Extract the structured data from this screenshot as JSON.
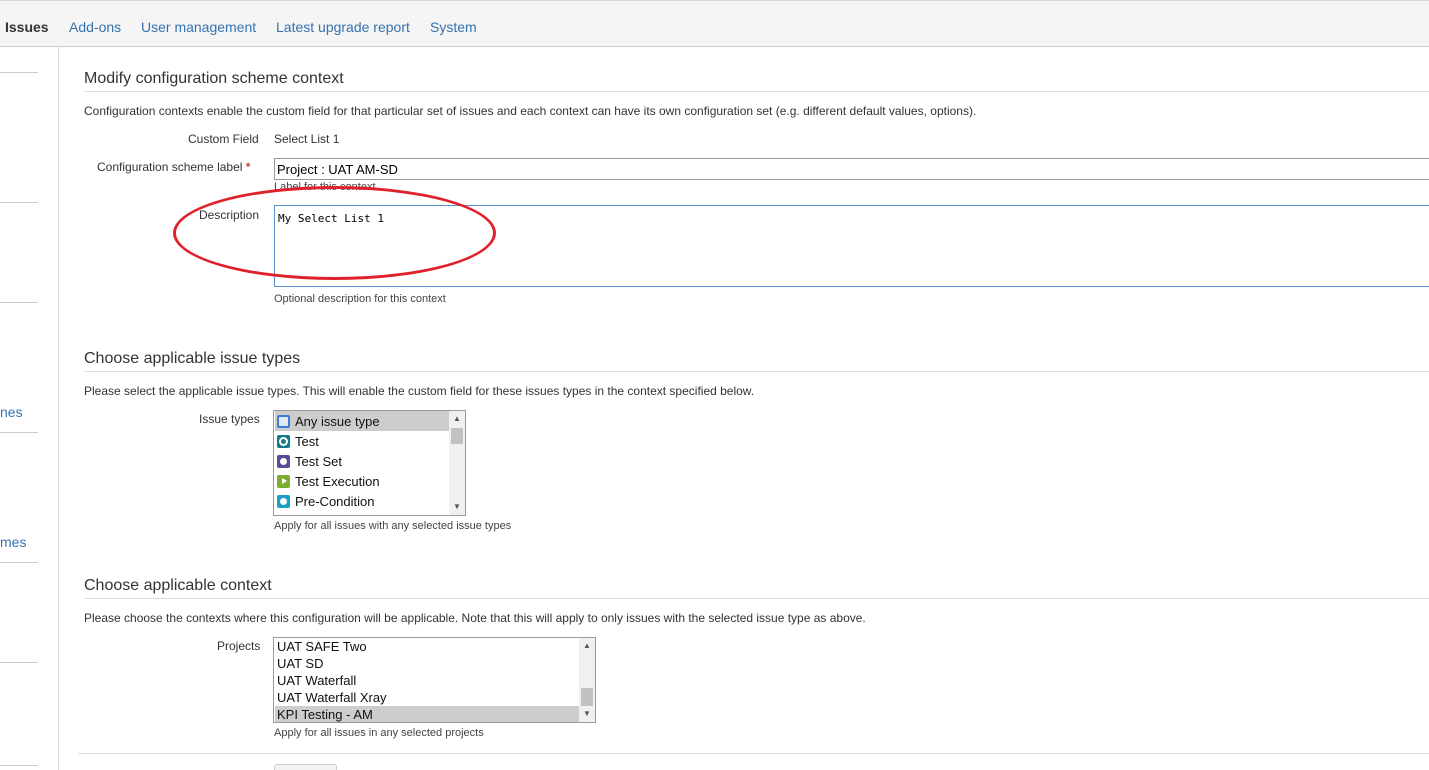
{
  "nav": {
    "tabs": [
      {
        "label": "Issues",
        "active": true
      },
      {
        "label": "Add-ons"
      },
      {
        "label": "User management"
      },
      {
        "label": "Latest upgrade report"
      },
      {
        "label": "System"
      }
    ]
  },
  "sidebar": {
    "fragments": [
      "nes",
      "mes"
    ]
  },
  "form": {
    "title": "Modify configuration scheme context",
    "intro": "Configuration contexts enable the custom field for that particular set of issues and each context can have its own configuration set (e.g. different default values, options).",
    "custom_field_label": "Custom Field",
    "custom_field_value": "Select List 1",
    "scheme_label_label": "Configuration scheme label",
    "required_mark": "*",
    "scheme_label_value": "Project : UAT AM-SD",
    "scheme_label_hint": "Label for this context",
    "description_label": "Description",
    "description_value": "My Select List 1",
    "description_hint": "Optional description for this context"
  },
  "issue_types": {
    "title": "Choose applicable issue types",
    "intro": "Please select the applicable issue types. This will enable the custom field for these issues types in the context specified below.",
    "label": "Issue types",
    "options": [
      {
        "label": "Any issue type",
        "icon": "any-issue-type-icon",
        "selected": true
      },
      {
        "label": "Test",
        "icon": "test-icon"
      },
      {
        "label": "Test Set",
        "icon": "test-set-icon"
      },
      {
        "label": "Test Execution",
        "icon": "test-execution-icon"
      },
      {
        "label": "Pre-Condition",
        "icon": "pre-condition-icon"
      }
    ],
    "hint": "Apply for all issues with any selected issue types"
  },
  "context": {
    "title": "Choose applicable context",
    "intro": "Please choose the contexts where this configuration will be applicable. Note that this will apply to only issues with the selected issue type as above.",
    "label": "Projects",
    "options": [
      {
        "label": "UAT SAFE Two"
      },
      {
        "label": "UAT SD"
      },
      {
        "label": "UAT Waterfall"
      },
      {
        "label": "UAT Waterfall Xray"
      },
      {
        "label": "KPI Testing - AM",
        "selected": true
      }
    ],
    "hint": "Apply for all issues in any selected projects"
  },
  "colors": {
    "link": "#3572b0",
    "annotation": "#e0212b",
    "required": "#d04437"
  }
}
